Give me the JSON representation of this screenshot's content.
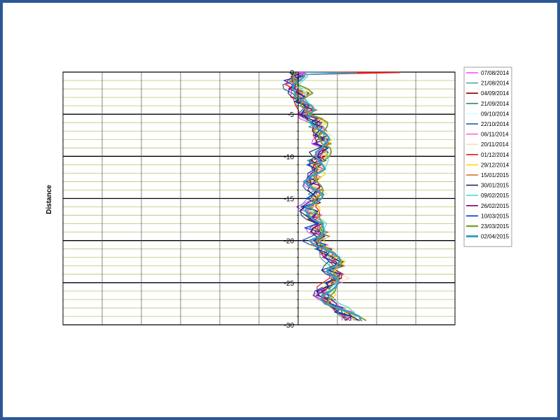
{
  "chart_data": {
    "type": "line",
    "title": "",
    "xlabel": "",
    "ylabel": "Distance",
    "ylim": [
      -30,
      0
    ],
    "y_ticks": [
      0,
      -5,
      -10,
      -15,
      -20,
      -25,
      -30
    ],
    "y_tick_labels": [
      "0",
      "-5",
      "-10",
      "-15",
      "-20",
      "-25",
      "-30"
    ],
    "xlim": [
      -60,
      40
    ],
    "grid": true,
    "legend_position": "right",
    "depth_profile": [
      [
        0,
        0.0
      ],
      [
        -0.5,
        0.2
      ],
      [
        -1,
        -0.8
      ],
      [
        -1.5,
        -1.5
      ],
      [
        -2,
        -0.5
      ],
      [
        -2.5,
        0.6
      ],
      [
        -3,
        0.0
      ],
      [
        -3.5,
        1.0
      ],
      [
        -4,
        2.0
      ],
      [
        -4.5,
        2.8
      ],
      [
        -5,
        2.5
      ],
      [
        -5.5,
        3.6
      ],
      [
        -6,
        4.5
      ],
      [
        -6.5,
        5.0
      ],
      [
        -7,
        5.8
      ],
      [
        -7.5,
        6.0
      ],
      [
        -8,
        6.5
      ],
      [
        -8.5,
        6.2
      ],
      [
        -9,
        6.8
      ],
      [
        -9.5,
        6.0
      ],
      [
        -10,
        5.5
      ],
      [
        -10.5,
        5.0
      ],
      [
        -11,
        4.8
      ],
      [
        -11.5,
        5.2
      ],
      [
        -12,
        4.5
      ],
      [
        -12.5,
        3.5
      ],
      [
        -13,
        3.2
      ],
      [
        -13.5,
        3.8
      ],
      [
        -14,
        4.5
      ],
      [
        -14.5,
        5.0
      ],
      [
        -15,
        4.2
      ],
      [
        -15.5,
        3.8
      ],
      [
        -16,
        2.8
      ],
      [
        -16.5,
        3.5
      ],
      [
        -17,
        4.0
      ],
      [
        -17.5,
        3.8
      ],
      [
        -18,
        4.8
      ],
      [
        -18.5,
        4.5
      ],
      [
        -19,
        5.5
      ],
      [
        -19.5,
        6.0
      ],
      [
        -20,
        4.5
      ],
      [
        -20.5,
        5.5
      ],
      [
        -21,
        6.8
      ],
      [
        -21.5,
        7.5
      ],
      [
        -22,
        8.5
      ],
      [
        -22.5,
        9.5
      ],
      [
        -23,
        10.0
      ],
      [
        -23.5,
        9.0
      ],
      [
        -24,
        9.5
      ],
      [
        -24.5,
        10.0
      ],
      [
        -25,
        9.0
      ],
      [
        -25.5,
        7.5
      ],
      [
        -26,
        7.0
      ],
      [
        -26.5,
        6.8
      ],
      [
        -27,
        7.5
      ],
      [
        -27.5,
        8.5
      ],
      [
        -28,
        10.5
      ],
      [
        -28.5,
        12.0
      ],
      [
        -29,
        13.5
      ],
      [
        -29.5,
        14.5
      ]
    ],
    "surface_spikes": [
      {
        "series": 8,
        "x": 26,
        "y": -0.05
      },
      {
        "series": 16,
        "x": 15,
        "y": -0.1
      },
      {
        "series": 0,
        "x": 2,
        "y": -0.2
      }
    ],
    "series": [
      {
        "name": "07/08/2014",
        "color": "#ff40ff",
        "offset": -1.0
      },
      {
        "name": "21/08/2014",
        "color": "#5aa69a",
        "offset": -0.6
      },
      {
        "name": "04/09/2014",
        "color": "#8b0000",
        "offset": 0.3
      },
      {
        "name": "21/09/2014",
        "color": "#2e8b7a",
        "offset": -0.3
      },
      {
        "name": "09/10/2014",
        "color": "#ccffff",
        "offset": 0.8
      },
      {
        "name": "22/10/2014",
        "color": "#1f4e9a",
        "offset": -1.2
      },
      {
        "name": "06/11/2014",
        "color": "#ff66cc",
        "offset": 0.2
      },
      {
        "name": "20/11/2014",
        "color": "#f5deb3",
        "offset": 1.0
      },
      {
        "name": "01/12/2014",
        "color": "#e41a1c",
        "offset": -0.4
      },
      {
        "name": "29/12/2014",
        "color": "#ffd700",
        "offset": 0.6
      },
      {
        "name": "15/01/2015",
        "color": "#d2691e",
        "offset": 0.0
      },
      {
        "name": "30/01/2015",
        "color": "#1f2a6b",
        "offset": -0.8
      },
      {
        "name": "09/02/2015",
        "color": "#40e0d0",
        "offset": 0.4
      },
      {
        "name": "26/02/2015",
        "color": "#800080",
        "offset": -0.2
      },
      {
        "name": "10/03/2015",
        "color": "#0033cc",
        "offset": -0.5
      },
      {
        "name": "23/03/2015",
        "color": "#7ba23f",
        "offset": 0.9,
        "width": 2
      },
      {
        "name": "02/04/2015",
        "color": "#3a9fc0",
        "offset": 0.1,
        "width": 2.5
      }
    ]
  }
}
